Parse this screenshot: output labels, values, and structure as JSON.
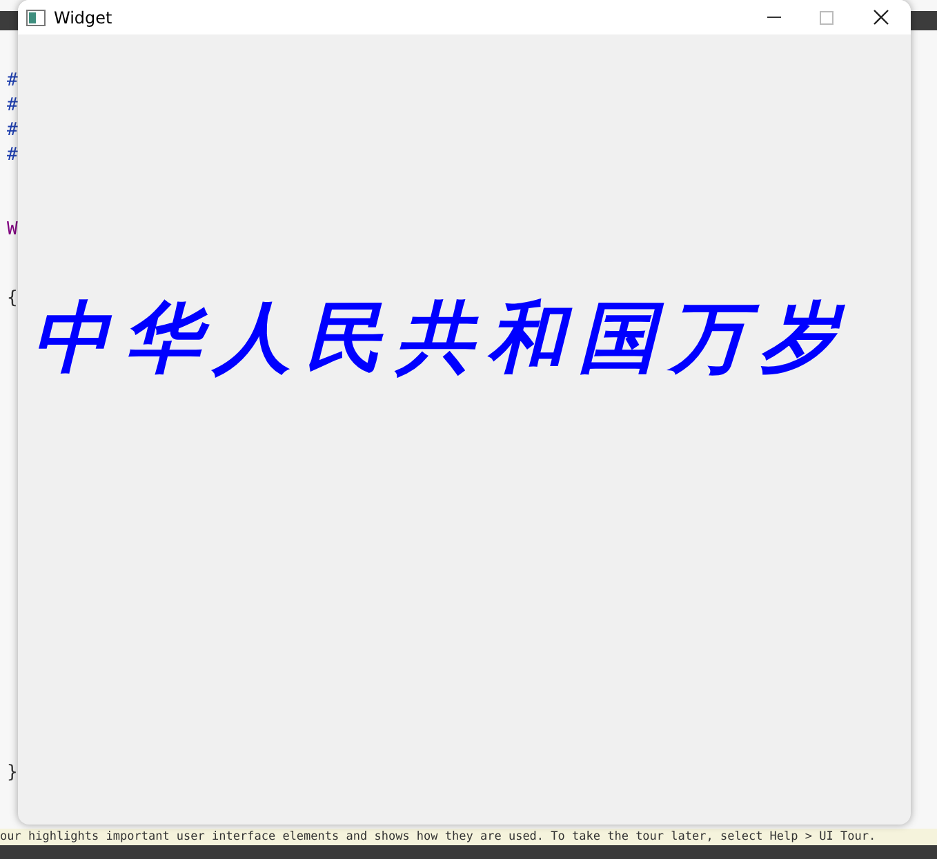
{
  "background_editor": {
    "lines": [
      {
        "text": "#",
        "kind": "directive"
      },
      {
        "text": "#",
        "kind": "directive"
      },
      {
        "text": "#",
        "kind": "directive"
      },
      {
        "text": "#",
        "kind": "directive"
      },
      {
        "text": "W",
        "kind": "keyword"
      },
      {
        "text": "{",
        "kind": "plain"
      },
      {
        "text": "}",
        "kind": "plain"
      }
    ],
    "tour_notice": "our highlights important user interface elements and shows how they are used. To take the tour later, select Help > UI Tour."
  },
  "window": {
    "title": "Widget",
    "content": "中华人民共和国万岁"
  }
}
